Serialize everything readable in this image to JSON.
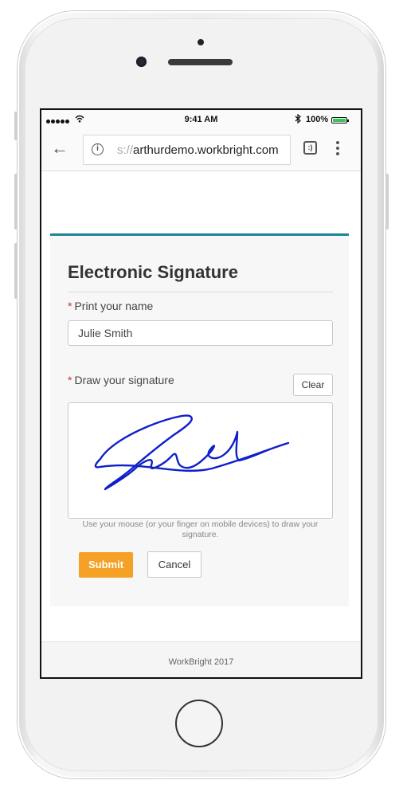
{
  "status_bar": {
    "signal_icon": "signal-dots-icon",
    "wifi_icon": "wifi-icon",
    "time": "9:41 AM",
    "bluetooth_icon": "bluetooth-icon",
    "battery_percent": "100%",
    "battery_level": 1.0,
    "battery_color": "#35c759"
  },
  "browser": {
    "back_icon": "back-arrow-icon",
    "info_icon": "info-icon",
    "url_prefix": "s://",
    "url_host": "arthurdemo.workbright.com",
    "tab_switcher_label": ":)",
    "menu_icon": "more-vertical-icon"
  },
  "form": {
    "accent_color": "#1e8497",
    "title": "Electronic Signature",
    "required_marker": "*",
    "name_label": "Print your name",
    "name_value": "Julie Smith",
    "signature_label": "Draw your signature",
    "clear_label": "Clear",
    "signature_stroke_color": "#1020c8",
    "signature_hint": "Use your mouse (or your finger on mobile devices) to draw your signature.",
    "submit_label": "Submit",
    "submit_color": "#f4a125",
    "cancel_label": "Cancel"
  },
  "footer": {
    "text": "WorkBright 2017"
  }
}
